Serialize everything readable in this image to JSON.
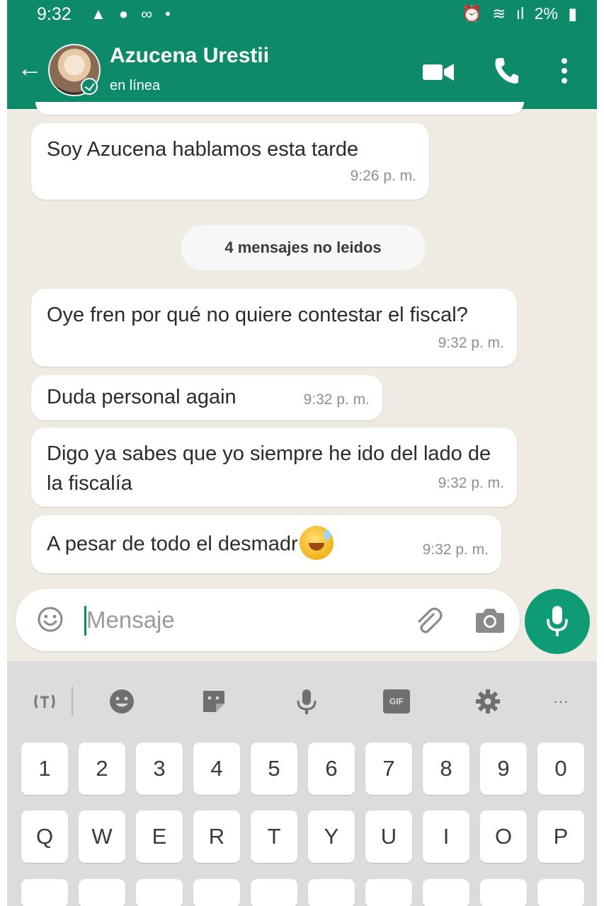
{
  "status_bar": {
    "time": "9:32",
    "battery": "2%"
  },
  "header": {
    "contact_name": "Azucena Urestii",
    "presence": "en línea",
    "icons": [
      "back-arrow-icon",
      "video-call-icon",
      "phone-icon",
      "more-vert-icon"
    ],
    "accent": "#0d8a6a"
  },
  "chat": {
    "messages": [
      {
        "text": "Soy Azucena hablamos esta tarde",
        "time": "9:26 p. m."
      },
      {
        "text": "Oye fren por qué no quiere contestar el fiscal?",
        "time": "9:32 p. m."
      },
      {
        "text": "Duda personal again",
        "time": "9:32 p. m."
      },
      {
        "text": "Digo ya sabes que yo siempre he ido del lado de la fiscalía",
        "time": "9:32 p. m."
      },
      {
        "text": "A pesar de todo el desmadr",
        "time": "9:32 p. m."
      }
    ],
    "unread_label": "4 mensajes no leidos"
  },
  "composer": {
    "placeholder": "Mensaje",
    "icons": [
      "emoji-icon",
      "attach-icon",
      "camera-icon",
      "mic-icon"
    ]
  },
  "keyboard": {
    "toolbar_icons": [
      "translate-icon",
      "emoji-icon",
      "sticker-icon",
      "voice-icon",
      "gif-icon",
      "settings-icon",
      "more-icon"
    ],
    "gif_label": "GIF",
    "more_label": "···",
    "number_row": [
      "1",
      "2",
      "3",
      "4",
      "5",
      "6",
      "7",
      "8",
      "9",
      "0"
    ],
    "letter_row": [
      "Q",
      "W",
      "E",
      "R",
      "T",
      "Y",
      "U",
      "I",
      "O",
      "P"
    ]
  }
}
